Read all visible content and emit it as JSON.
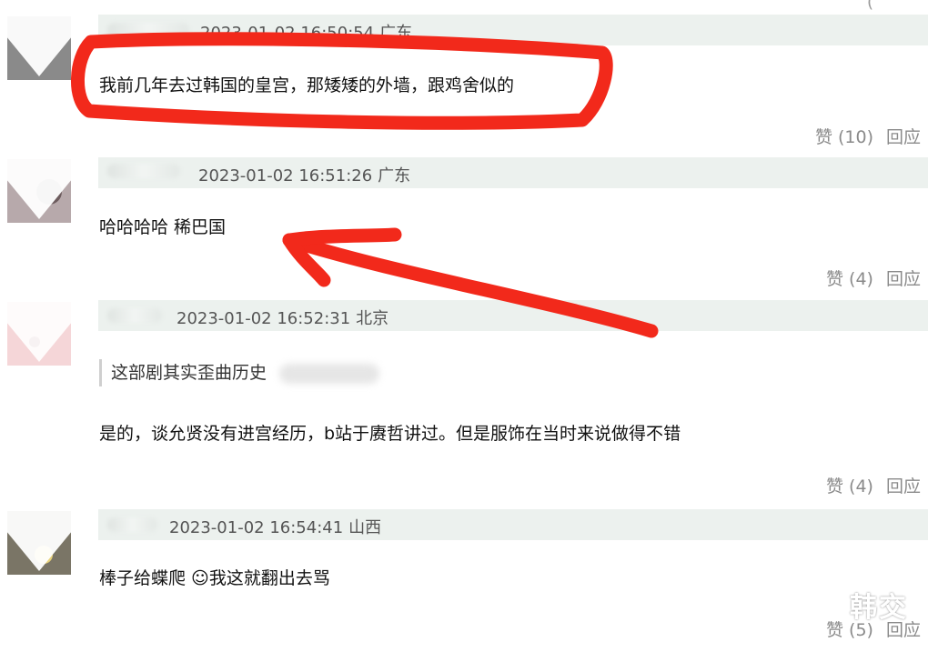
{
  "colors": {
    "header_bg": "#ecf1ee",
    "annotation": "#f2291b"
  },
  "comments": [
    {
      "timestamp": "2023-01-02 16:50:54",
      "location": "广东",
      "text": "我前几年去过韩国的皇宫，那矮矮的外墙，跟鸡舍似的",
      "like_label": "赞 (10)",
      "reply_label": "回应"
    },
    {
      "timestamp": "2023-01-02 16:51:26",
      "location": "广东",
      "text": "哈哈哈哈 稀巴国",
      "like_label": "赞 (4)",
      "reply_label": "回应"
    },
    {
      "timestamp": "2023-01-02 16:52:31",
      "location": "北京",
      "quote": "这部剧其实歪曲历史",
      "text": "是的，谈允贤没有进宫经历，b站于赓哲讲过。但是服饰在当时来说做得不错",
      "like_label": "赞 (4)",
      "reply_label": "回应"
    },
    {
      "timestamp": "2023-01-02 16:54:41",
      "location": "山西",
      "text": "棒子给蝶爬 ☺我这就翻出去骂",
      "like_label": "赞 (5)",
      "reply_label": "回应"
    }
  ],
  "watermark": "韩交"
}
